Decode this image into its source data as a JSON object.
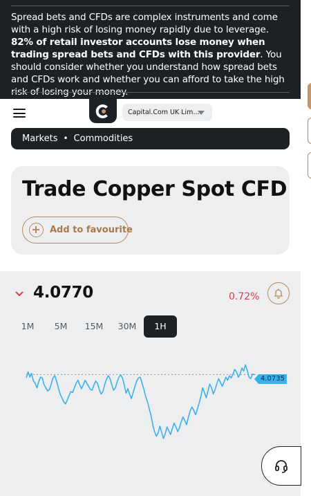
{
  "risk_warning": {
    "text_start": "Spread bets and CFDs are complex instruments and come with a high risk of losing money rapidly due to leverage. ",
    "text_bold": "82% of retail investor accounts lose money when trading spread bets and CFDs with this provider",
    "text_end": ". You should consider whether you understand how spread bets and CFDs work and whether you can afford to take the high risk of losing your money."
  },
  "header": {
    "entity_selector": "Capital.Com UK Lim..."
  },
  "breadcrumb": {
    "items": [
      "Markets",
      "Commodities"
    ],
    "separator": "•"
  },
  "instrument": {
    "title": "Trade Copper Spot CFD",
    "favourite_label": "Add to favourite"
  },
  "quote": {
    "price": "4.0770",
    "change": "0.72%",
    "direction": "down",
    "last_price_tag": "4.0735"
  },
  "timeframes": {
    "items": [
      "1M",
      "5M",
      "15M",
      "30M",
      "1H"
    ],
    "active": "1H"
  },
  "colors": {
    "dark": "#1d2125",
    "accent": "#b78a5c",
    "negative": "#e0394a",
    "line": "#3ab1ea",
    "panel": "#eceeef"
  },
  "chart_data": {
    "type": "line",
    "ylim": [
      3.96,
      4.1
    ],
    "reference_line": 4.0735,
    "last_value": 4.0735,
    "series": [
      {
        "values": [
          4.069,
          4.077,
          4.07,
          4.075,
          4.065,
          4.062,
          4.056,
          4.064,
          4.07,
          4.069,
          4.06,
          4.056,
          4.052,
          4.054,
          4.061,
          4.069,
          4.072,
          4.065,
          4.056,
          4.048,
          4.043,
          4.038,
          4.035,
          4.04,
          4.046,
          4.051,
          4.05,
          4.056,
          4.062,
          4.066,
          4.06,
          4.055,
          4.06,
          4.066,
          4.062,
          4.058,
          4.054,
          4.053,
          4.06,
          4.065,
          4.062,
          4.054,
          4.048,
          4.051,
          4.06,
          4.067,
          4.072,
          4.068,
          4.06,
          4.053,
          4.056,
          4.064,
          4.07,
          4.073,
          4.069,
          4.06,
          4.049,
          4.055,
          4.048,
          4.042,
          4.05,
          4.058,
          4.065,
          4.069,
          4.07,
          4.062,
          4.054,
          4.045,
          4.038,
          4.029,
          4.02,
          4.008,
          3.999,
          3.993,
          3.997,
          4.006,
          3.998,
          3.99,
          3.996,
          4.005,
          4.0,
          3.995,
          4.003,
          4.01,
          4.005,
          3.999,
          4.004,
          4.012,
          4.018,
          4.013,
          4.008,
          4.018,
          4.026,
          4.031,
          4.027,
          4.021,
          4.028,
          4.036,
          4.045,
          4.056,
          4.05,
          4.043,
          4.052,
          4.061,
          4.056,
          4.048,
          4.054,
          4.062,
          4.068,
          4.063,
          4.058,
          4.064,
          4.07,
          4.066,
          4.072,
          4.069,
          4.074,
          4.08,
          4.077,
          4.07,
          4.074,
          4.082,
          4.078,
          4.086,
          4.079,
          4.07,
          4.068,
          4.074,
          4.0735
        ]
      }
    ]
  }
}
